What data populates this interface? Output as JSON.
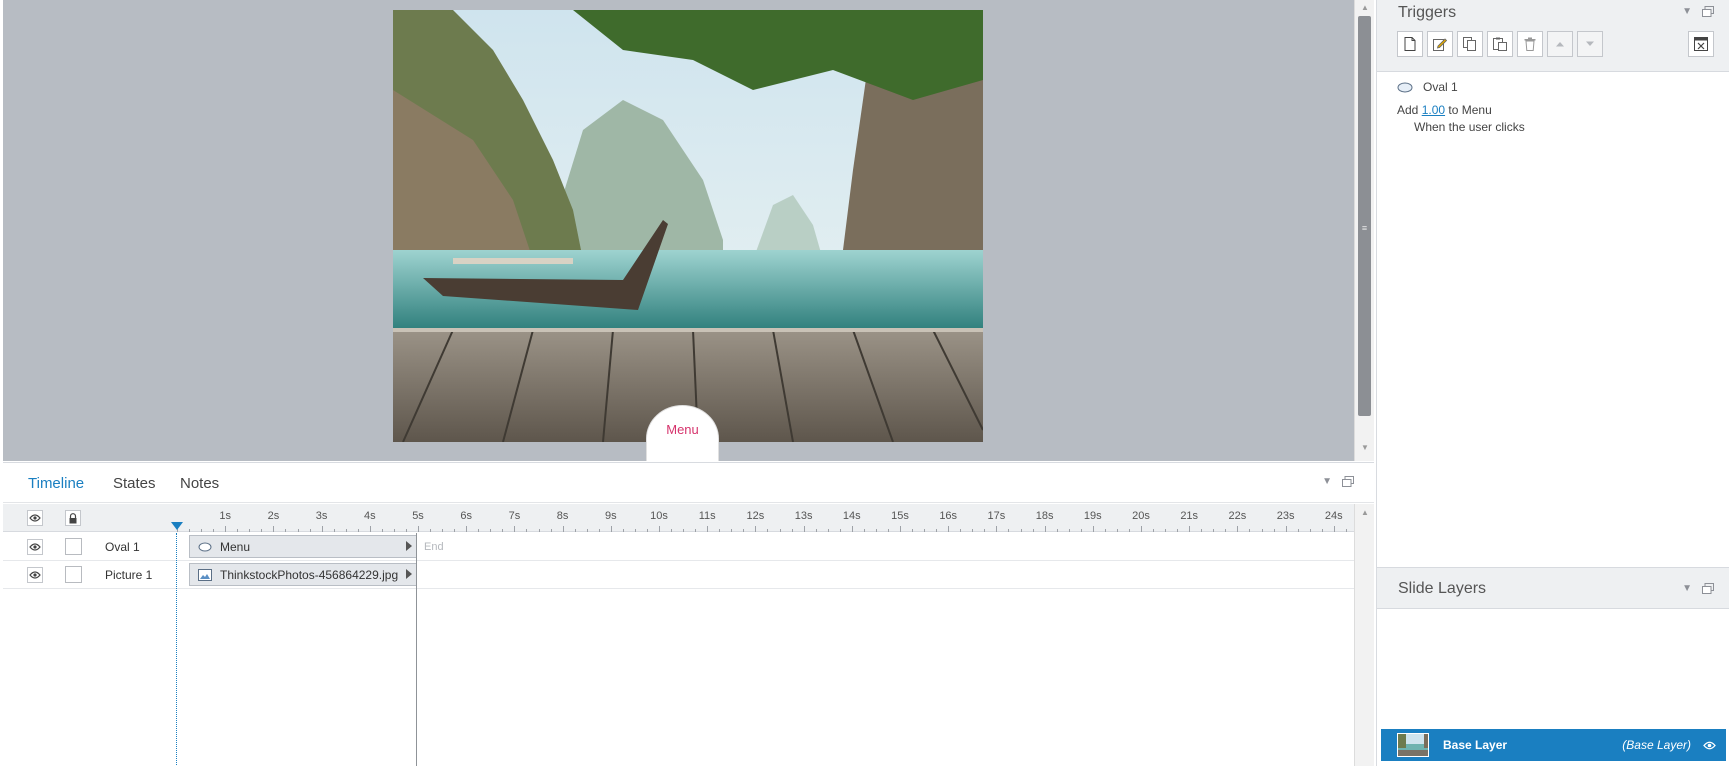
{
  "stage": {
    "menu_label": "Menu"
  },
  "timeline": {
    "tabs": [
      {
        "label": "Timeline",
        "active": true
      },
      {
        "label": "States",
        "active": false
      },
      {
        "label": "Notes",
        "active": false
      }
    ],
    "ruler_labels": [
      "1s",
      "2s",
      "3s",
      "4s",
      "5s",
      "6s",
      "7s",
      "8s",
      "9s",
      "10s",
      "11s",
      "12s",
      "13s",
      "14s",
      "15s",
      "16s",
      "17s",
      "18s",
      "19s",
      "20s",
      "21s",
      "22s",
      "23s",
      "24s"
    ],
    "end_label": "End",
    "rows": [
      {
        "name": "Oval 1",
        "bar_label": "Menu",
        "bar_icon": "oval-icon"
      },
      {
        "name": "Picture 1",
        "bar_label": "ThinkstockPhotos-456864229.jpg",
        "bar_icon": "picture-icon"
      }
    ]
  },
  "triggers": {
    "title": "Triggers",
    "object_name": "Oval 1",
    "action_prefix": "Add",
    "action_value": "1.00",
    "action_suffix": "to Menu",
    "condition": "When the user clicks"
  },
  "layers": {
    "title": "Slide Layers",
    "base_name": "Base Layer",
    "base_tag": "(Base Layer)"
  },
  "colors": {
    "accent": "#1a7fc1",
    "stage_bg": "#b7bcc3",
    "menu_text": "#d6336c"
  }
}
